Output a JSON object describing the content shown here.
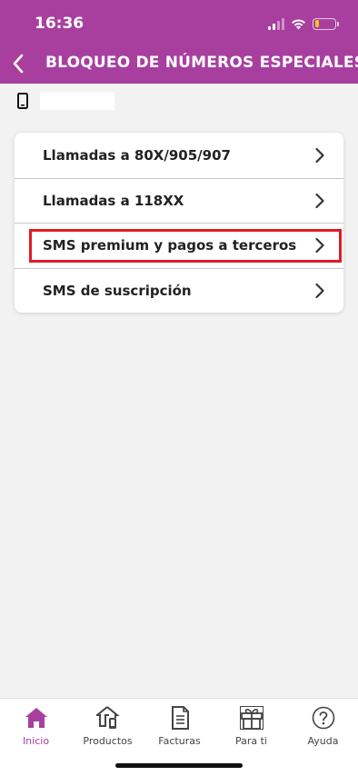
{
  "status_bar": {
    "time": "16:36",
    "battery_level": 0.2,
    "battery_color": "#f5c518"
  },
  "header": {
    "title": "BLOQUEO DE NÚMEROS ESPECIALES",
    "back_icon": "chevron-left-icon",
    "background": "#a83f9f"
  },
  "line": {
    "icon": "mobile-phone-icon",
    "number": ""
  },
  "menu": {
    "items": [
      {
        "label": "Llamadas a 80X/905/907"
      },
      {
        "label": "Llamadas a 118XX"
      },
      {
        "label": "SMS premium y pagos a terceros",
        "highlighted": true
      },
      {
        "label": "SMS de suscripción"
      }
    ],
    "highlight_color": "#e01b24"
  },
  "bottom_nav": {
    "items": [
      {
        "label": "Inicio",
        "icon": "home-icon",
        "active": true
      },
      {
        "label": "Productos",
        "icon": "products-icon"
      },
      {
        "label": "Facturas",
        "icon": "invoice-icon"
      },
      {
        "label": "Para ti",
        "icon": "gift-icon"
      },
      {
        "label": "Ayuda",
        "icon": "help-icon"
      }
    ],
    "active_color": "#a83f9f"
  }
}
